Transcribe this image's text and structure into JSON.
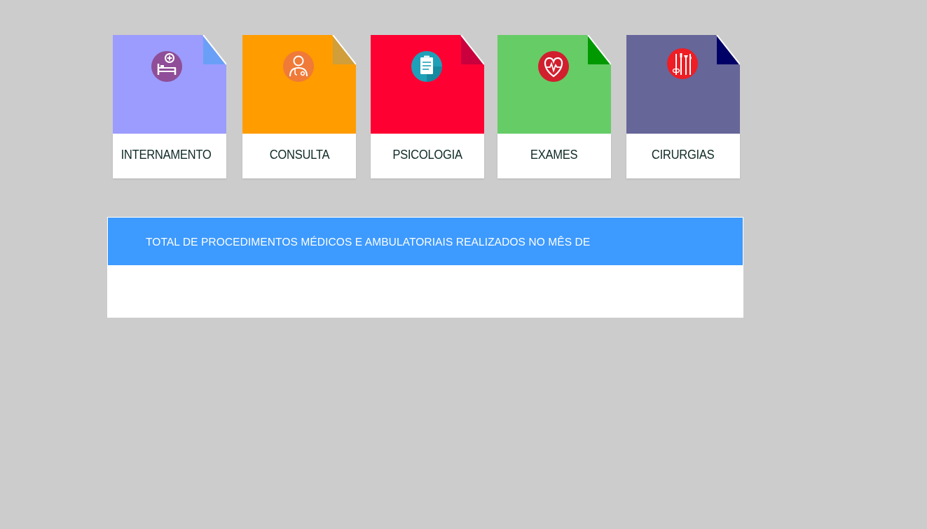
{
  "cards": [
    {
      "label": "INTERNAMENTO",
      "color": "#9b9cfe",
      "fold_color": "#6a9ff8",
      "icon": "hospital-bed-icon",
      "icon_bg": "#8f4e97"
    },
    {
      "label": "CONSULTA",
      "color": "#ff9c00",
      "fold_color": "#d09e3a",
      "icon": "doctor-icon",
      "icon_bg": "#f07a38"
    },
    {
      "label": "PSICOLOGIA",
      "color": "#ff0033",
      "fold_color": "#c9003d",
      "icon": "clipboard-icon",
      "icon_bg": "#1fa0b8"
    },
    {
      "label": "EXAMES",
      "color": "#66cc66",
      "fold_color": "#009900",
      "icon": "heart-pulse-icon",
      "icon_bg": "#d11f2e"
    },
    {
      "label": "CIRURGIAS",
      "color": "#666699",
      "fold_color": "#000066",
      "icon": "surgical-tools-icon",
      "icon_bg": "#ef1d24"
    }
  ],
  "panel": {
    "title": "TOTAL DE PROCEDIMENTOS MÉDICOS E AMBULATORIAIS REALIZADOS NO MÊS DE",
    "header_color": "#3d9aff",
    "body_text": ""
  }
}
